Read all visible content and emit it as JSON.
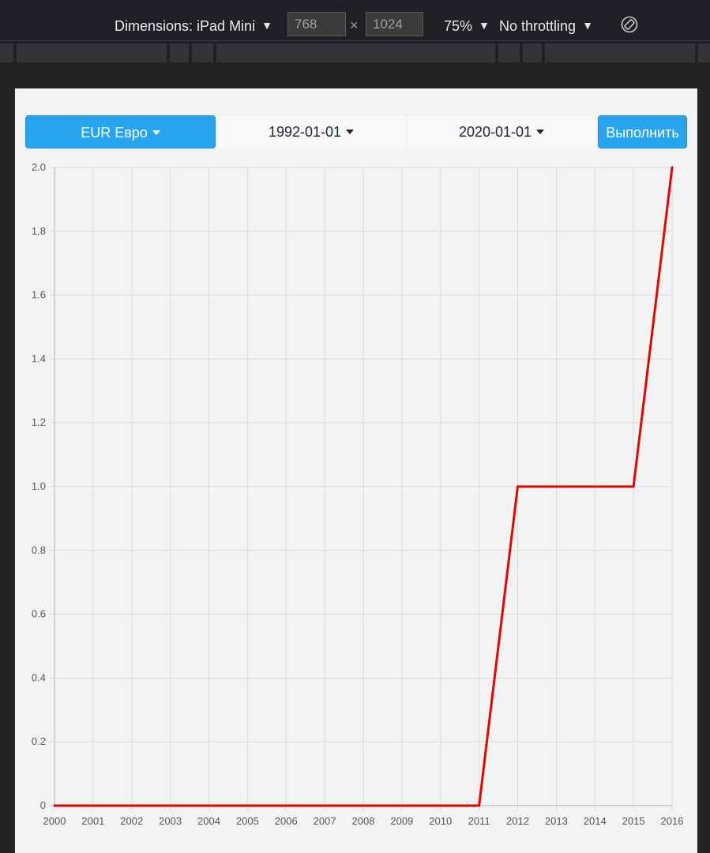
{
  "devtools": {
    "dimensions_label": "Dimensions: iPad Mini",
    "width_value": "768",
    "height_value": "1024",
    "times_symbol": "×",
    "zoom_label": "75%",
    "throttling_label": "No throttling",
    "caret": "▼",
    "rotate_icon": "rotate-icon"
  },
  "controls": {
    "currency_label": "EUR Евро",
    "date_from_label": "1992-01-01",
    "date_to_label": "2020-01-01",
    "execute_label": "Выполнить"
  },
  "colors": {
    "primary": "#28a3ee",
    "line": "#ee0000",
    "grid": "#d9dadc"
  },
  "chart_data": {
    "type": "line",
    "x": [
      "2000",
      "2001",
      "2002",
      "2003",
      "2004",
      "2005",
      "2006",
      "2007",
      "2008",
      "2009",
      "2010",
      "2011",
      "2012",
      "2013",
      "2014",
      "2015",
      "2016"
    ],
    "series": [
      {
        "values": [
          0,
          0,
          0,
          0,
          0,
          0,
          0,
          0,
          0,
          0,
          0,
          0,
          1,
          1,
          1,
          1,
          2
        ]
      }
    ],
    "ylim": [
      0,
      2
    ],
    "yticks": [
      "0",
      "0.2",
      "0.4",
      "0.6",
      "0.8",
      "1.0",
      "1.2",
      "1.4",
      "1.6",
      "1.8",
      "2.0"
    ],
    "grid": true
  }
}
